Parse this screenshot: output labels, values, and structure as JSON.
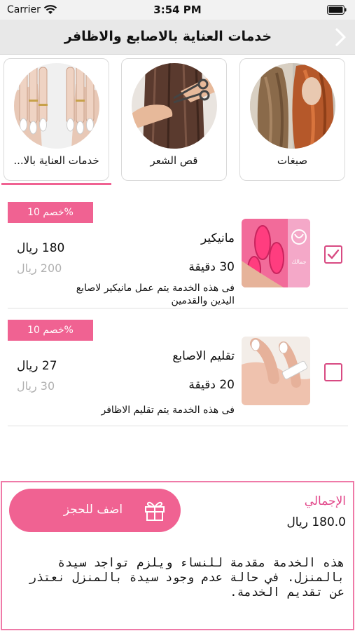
{
  "status_bar": {
    "carrier": "Carrier",
    "time": "3:54 PM"
  },
  "nav": {
    "title": "خدمات العناية بالاصابع والاظافر",
    "back_icon": "chevron-right-icon"
  },
  "categories": [
    {
      "label": "صبغات",
      "image": "hair-color-photo"
    },
    {
      "label": "قص الشعر",
      "image": "hair-cut-photo"
    },
    {
      "label": "خدمات العناية بالا...",
      "image": "nails-photo",
      "selected": true
    }
  ],
  "services": [
    {
      "discount": "خصم 10%",
      "name": "مانيكير",
      "duration": "30 دقيقة",
      "price": "180 ريال",
      "old_price": "200 ريال",
      "description": "فى هذه الخدمة يتم عمل مانيكير لاصابع اليدين والقدمين",
      "thumb_text": "جمالك",
      "checked": true
    },
    {
      "discount": "خصم 10%",
      "name": "تقليم الاصابع",
      "duration": "20 دقيقة",
      "price": "27 ريال",
      "old_price": "30 ريال",
      "description": "فى هذه الخدمة يتم تقليم الاظافر",
      "checked": false
    }
  ],
  "footer": {
    "book_label": "اضف للحجز",
    "total_label": "الإجمالي",
    "total_value": "180.0 ريال",
    "notice": "هذه الخدمة مقدمة للنساء ويلزم تواجد سيدة بالمنزل. في حالة عدم وجود سيدة بالمنزل نعتذر عن تقديم الخدمة."
  },
  "colors": {
    "accent": "#f06292",
    "accent_dark": "#d84a82",
    "nav_bg": "#e8e8e8"
  }
}
